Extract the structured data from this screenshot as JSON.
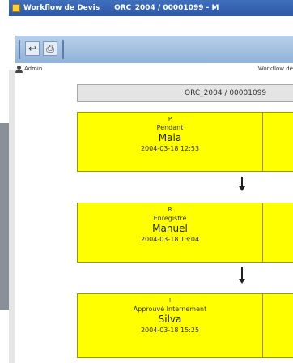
{
  "window": {
    "app_title": "Workflow de Devis",
    "doc_title": "ORC_2004 / 00001099 - M"
  },
  "userbar": {
    "user": "Admin",
    "breadcrumb": "Workflow de"
  },
  "document": {
    "reference": "ORC_2004 / 00001099"
  },
  "steps": [
    {
      "code": "P",
      "status": "Pendant",
      "person": "Maia",
      "date": "2004-03-18 12:53"
    },
    {
      "code": "R",
      "status": "Enregistré",
      "person": "Manuel",
      "date": "2004-03-18 13:04"
    },
    {
      "code": "I",
      "status": "Approuvé Internement",
      "person": "Silva",
      "date": "2004-03-18 15:25"
    }
  ],
  "colors": {
    "step_fill": "#ffff00",
    "toolbar": "#a8c3e3",
    "titlebar": "#3566b3"
  }
}
